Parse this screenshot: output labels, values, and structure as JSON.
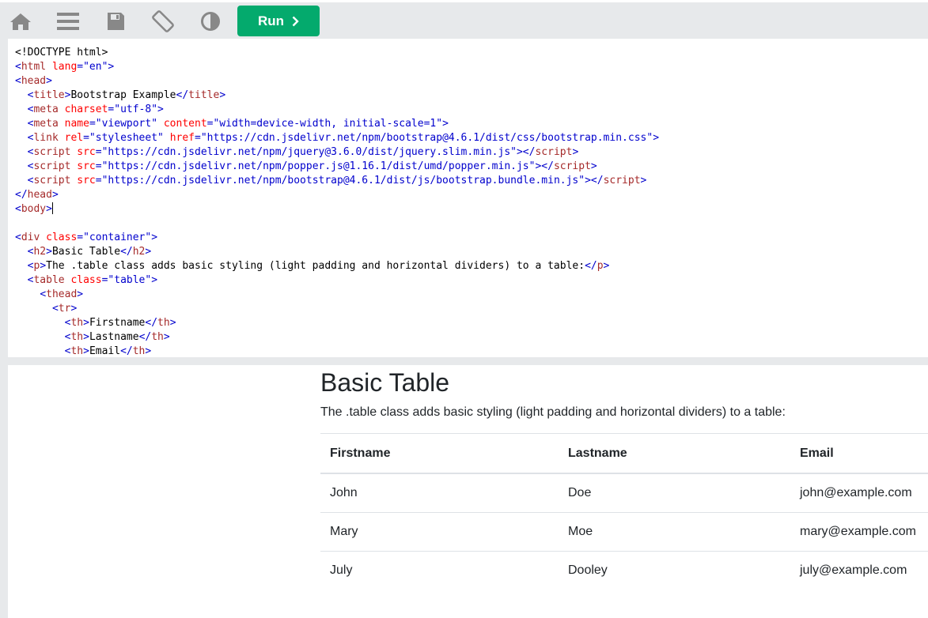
{
  "toolbar": {
    "icons": [
      "home-icon",
      "menu-icon",
      "save-icon",
      "rotate-icon",
      "contrast-icon"
    ],
    "run_label": "Run",
    "colors": {
      "run": "#04aa6d",
      "icon": "#888888"
    }
  },
  "editor": {
    "lines": [
      [
        {
          "t": "plain",
          "v": "<!DOCTYPE html>"
        }
      ],
      [
        {
          "t": "br",
          "v": "<"
        },
        {
          "t": "tag",
          "v": "html"
        },
        {
          "t": "plain",
          "v": " "
        },
        {
          "t": "attr",
          "v": "lang"
        },
        {
          "t": "br",
          "v": "=\"en\">"
        }
      ],
      [
        {
          "t": "br",
          "v": "<"
        },
        {
          "t": "tag",
          "v": "head"
        },
        {
          "t": "br",
          "v": ">"
        }
      ],
      [
        {
          "t": "plain",
          "v": "  "
        },
        {
          "t": "br",
          "v": "<"
        },
        {
          "t": "tag",
          "v": "title"
        },
        {
          "t": "br",
          "v": ">"
        },
        {
          "t": "plain",
          "v": "Bootstrap Example"
        },
        {
          "t": "br",
          "v": "</"
        },
        {
          "t": "tag",
          "v": "title"
        },
        {
          "t": "br",
          "v": ">"
        }
      ],
      [
        {
          "t": "plain",
          "v": "  "
        },
        {
          "t": "br",
          "v": "<"
        },
        {
          "t": "tag",
          "v": "meta"
        },
        {
          "t": "plain",
          "v": " "
        },
        {
          "t": "attr",
          "v": "charset"
        },
        {
          "t": "br",
          "v": "=\"utf-8\">"
        }
      ],
      [
        {
          "t": "plain",
          "v": "  "
        },
        {
          "t": "br",
          "v": "<"
        },
        {
          "t": "tag",
          "v": "meta"
        },
        {
          "t": "plain",
          "v": " "
        },
        {
          "t": "attr",
          "v": "name"
        },
        {
          "t": "val",
          "v": "=\"viewport\""
        },
        {
          "t": "plain",
          "v": " "
        },
        {
          "t": "attr",
          "v": "content"
        },
        {
          "t": "val",
          "v": "=\"width=device-width, initial-scale=1\""
        },
        {
          "t": "br",
          "v": ">"
        }
      ],
      [
        {
          "t": "plain",
          "v": "  "
        },
        {
          "t": "br",
          "v": "<"
        },
        {
          "t": "tag",
          "v": "link"
        },
        {
          "t": "plain",
          "v": " "
        },
        {
          "t": "attr",
          "v": "rel"
        },
        {
          "t": "val",
          "v": "=\"stylesheet\""
        },
        {
          "t": "plain",
          "v": " "
        },
        {
          "t": "attr",
          "v": "href"
        },
        {
          "t": "val",
          "v": "=\"https://cdn.jsdelivr.net/npm/bootstrap@4.6.1/dist/css/bootstrap.min.css\""
        },
        {
          "t": "br",
          "v": ">"
        }
      ],
      [
        {
          "t": "plain",
          "v": "  "
        },
        {
          "t": "br",
          "v": "<"
        },
        {
          "t": "tag",
          "v": "script"
        },
        {
          "t": "plain",
          "v": " "
        },
        {
          "t": "attr",
          "v": "src"
        },
        {
          "t": "val",
          "v": "=\"https://cdn.jsdelivr.net/npm/jquery@3.6.0/dist/jquery.slim.min.js\""
        },
        {
          "t": "br",
          "v": "></"
        },
        {
          "t": "tag",
          "v": "script"
        },
        {
          "t": "br",
          "v": ">"
        }
      ],
      [
        {
          "t": "plain",
          "v": "  "
        },
        {
          "t": "br",
          "v": "<"
        },
        {
          "t": "tag",
          "v": "script"
        },
        {
          "t": "plain",
          "v": " "
        },
        {
          "t": "attr",
          "v": "src"
        },
        {
          "t": "val",
          "v": "=\"https://cdn.jsdelivr.net/npm/popper.js@1.16.1/dist/umd/popper.min.js\""
        },
        {
          "t": "br",
          "v": "></"
        },
        {
          "t": "tag",
          "v": "script"
        },
        {
          "t": "br",
          "v": ">"
        }
      ],
      [
        {
          "t": "plain",
          "v": "  "
        },
        {
          "t": "br",
          "v": "<"
        },
        {
          "t": "tag",
          "v": "script"
        },
        {
          "t": "plain",
          "v": " "
        },
        {
          "t": "attr",
          "v": "src"
        },
        {
          "t": "val",
          "v": "=\"https://cdn.jsdelivr.net/npm/bootstrap@4.6.1/dist/js/bootstrap.bundle.min.js\""
        },
        {
          "t": "br",
          "v": "></"
        },
        {
          "t": "tag",
          "v": "script"
        },
        {
          "t": "br",
          "v": ">"
        }
      ],
      [
        {
          "t": "br",
          "v": "</"
        },
        {
          "t": "tag",
          "v": "head"
        },
        {
          "t": "br",
          "v": ">"
        }
      ],
      [
        {
          "t": "br",
          "v": "<"
        },
        {
          "t": "tag",
          "v": "body"
        },
        {
          "t": "br",
          "v": ">"
        },
        {
          "t": "cursor",
          "v": ""
        }
      ],
      [],
      [
        {
          "t": "br",
          "v": "<"
        },
        {
          "t": "tag",
          "v": "div"
        },
        {
          "t": "plain",
          "v": " "
        },
        {
          "t": "attr",
          "v": "class"
        },
        {
          "t": "val",
          "v": "=\"container\""
        },
        {
          "t": "br",
          "v": ">"
        }
      ],
      [
        {
          "t": "plain",
          "v": "  "
        },
        {
          "t": "br",
          "v": "<"
        },
        {
          "t": "tag",
          "v": "h2"
        },
        {
          "t": "br",
          "v": ">"
        },
        {
          "t": "plain",
          "v": "Basic Table"
        },
        {
          "t": "br",
          "v": "</"
        },
        {
          "t": "tag",
          "v": "h2"
        },
        {
          "t": "br",
          "v": ">"
        }
      ],
      [
        {
          "t": "plain",
          "v": "  "
        },
        {
          "t": "br",
          "v": "<"
        },
        {
          "t": "tag",
          "v": "p"
        },
        {
          "t": "br",
          "v": ">"
        },
        {
          "t": "plain",
          "v": "The .table class adds basic styling (light padding and horizontal dividers) to a table:"
        },
        {
          "t": "br",
          "v": "</"
        },
        {
          "t": "tag",
          "v": "p"
        },
        {
          "t": "br",
          "v": ">"
        }
      ],
      [
        {
          "t": "plain",
          "v": "  "
        },
        {
          "t": "br",
          "v": "<"
        },
        {
          "t": "tag",
          "v": "table"
        },
        {
          "t": "plain",
          "v": " "
        },
        {
          "t": "attr",
          "v": "class"
        },
        {
          "t": "val",
          "v": "=\"table\""
        },
        {
          "t": "br",
          "v": ">"
        }
      ],
      [
        {
          "t": "plain",
          "v": "    "
        },
        {
          "t": "br",
          "v": "<"
        },
        {
          "t": "tag",
          "v": "thead"
        },
        {
          "t": "br",
          "v": ">"
        }
      ],
      [
        {
          "t": "plain",
          "v": "      "
        },
        {
          "t": "br",
          "v": "<"
        },
        {
          "t": "tag",
          "v": "tr"
        },
        {
          "t": "br",
          "v": ">"
        }
      ],
      [
        {
          "t": "plain",
          "v": "        "
        },
        {
          "t": "br",
          "v": "<"
        },
        {
          "t": "tag",
          "v": "th"
        },
        {
          "t": "br",
          "v": ">"
        },
        {
          "t": "plain",
          "v": "Firstname"
        },
        {
          "t": "br",
          "v": "</"
        },
        {
          "t": "tag",
          "v": "th"
        },
        {
          "t": "br",
          "v": ">"
        }
      ],
      [
        {
          "t": "plain",
          "v": "        "
        },
        {
          "t": "br",
          "v": "<"
        },
        {
          "t": "tag",
          "v": "th"
        },
        {
          "t": "br",
          "v": ">"
        },
        {
          "t": "plain",
          "v": "Lastname"
        },
        {
          "t": "br",
          "v": "</"
        },
        {
          "t": "tag",
          "v": "th"
        },
        {
          "t": "br",
          "v": ">"
        }
      ],
      [
        {
          "t": "plain",
          "v": "        "
        },
        {
          "t": "br",
          "v": "<"
        },
        {
          "t": "tag",
          "v": "th"
        },
        {
          "t": "br",
          "v": ">"
        },
        {
          "t": "plain",
          "v": "Email"
        },
        {
          "t": "br",
          "v": "</"
        },
        {
          "t": "tag",
          "v": "th"
        },
        {
          "t": "br",
          "v": ">"
        }
      ]
    ]
  },
  "preview": {
    "title": "Basic Table",
    "description": "The .table class adds basic styling (light padding and horizontal dividers) to a table:",
    "headers": [
      "Firstname",
      "Lastname",
      "Email"
    ],
    "rows": [
      [
        "John",
        "Doe",
        "john@example.com"
      ],
      [
        "Mary",
        "Moe",
        "mary@example.com"
      ],
      [
        "July",
        "Dooley",
        "july@example.com"
      ]
    ]
  }
}
